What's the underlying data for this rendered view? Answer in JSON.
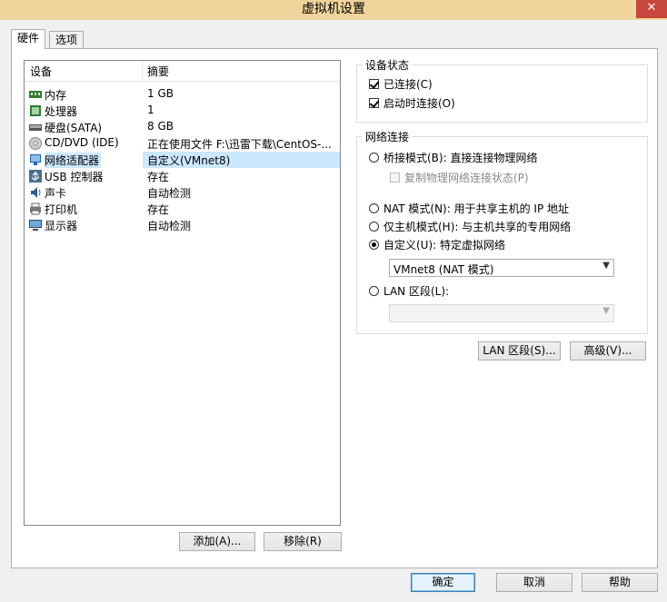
{
  "window": {
    "title": "虚拟机设置",
    "close_label": "✕"
  },
  "tabs": [
    {
      "label": "硬件",
      "active": true
    },
    {
      "label": "选项",
      "active": false
    }
  ],
  "device_list": {
    "columns": [
      "设备",
      "摘要"
    ],
    "rows": [
      {
        "icon": "memory-icon",
        "name": "内存",
        "summary": "1 GB"
      },
      {
        "icon": "processor-icon",
        "name": "处理器",
        "summary": "1"
      },
      {
        "icon": "hard-disk-icon",
        "name": "硬盘(SATA)",
        "summary": "8 GB"
      },
      {
        "icon": "cd-dvd-icon",
        "name": "CD/DVD (IDE)",
        "summary": "正在使用文件 F:\\迅雷下载\\CentOS-..."
      },
      {
        "icon": "network-adapter-icon",
        "name": "网络适配器",
        "summary": "自定义(VMnet8)",
        "selected": true
      },
      {
        "icon": "usb-icon",
        "name": "USB 控制器",
        "summary": "存在"
      },
      {
        "icon": "sound-card-icon",
        "name": "声卡",
        "summary": "自动检测"
      },
      {
        "icon": "printer-icon",
        "name": "打印机",
        "summary": "存在"
      },
      {
        "icon": "display-icon",
        "name": "显示器",
        "summary": "自动检测"
      }
    ]
  },
  "list_buttons": {
    "add": "添加(A)...",
    "remove": "移除(R)"
  },
  "device_status": {
    "title": "设备状态",
    "connected": {
      "label": "已连接(C)",
      "checked": true
    },
    "connect_on_power": {
      "label": "启动时连接(O)",
      "checked": true
    }
  },
  "network": {
    "title": "网络连接",
    "bridged": {
      "label": "桥接模式(B): 直接连接物理网络",
      "selected": false
    },
    "replicate": {
      "label": "复制物理网络连接状态(P)",
      "checked": false
    },
    "nat": {
      "label": "NAT 模式(N): 用于共享主机的 IP 地址",
      "selected": false
    },
    "host_only": {
      "label": "仅主机模式(H): 与主机共享的专用网络",
      "selected": false
    },
    "custom": {
      "label": "自定义(U): 特定虚拟网络",
      "selected": true
    },
    "custom_select": "VMnet8 (NAT 模式)",
    "lan_segment": {
      "label": "LAN 区段(L):",
      "selected": false
    },
    "lan_select": ""
  },
  "network_buttons": {
    "lan_segments": "LAN 区段(S)...",
    "advanced": "高级(V)..."
  },
  "footer": {
    "ok": "确定",
    "cancel": "取消",
    "help": "帮助"
  },
  "colors": {
    "selection": "#cce8ff",
    "title_bar": "#f0d49b",
    "close": "#c7463d"
  }
}
